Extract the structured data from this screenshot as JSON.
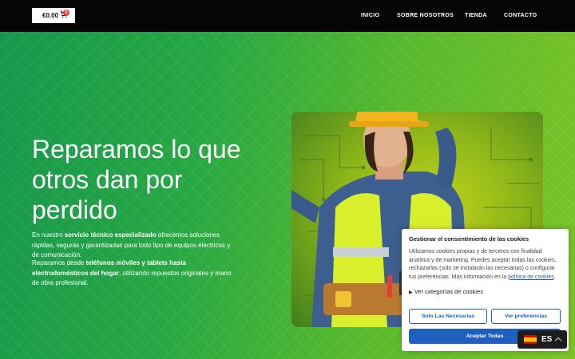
{
  "header": {
    "cart_price": "€0.00",
    "cart_count": "0",
    "nav": [
      {
        "label": "INICIO"
      },
      {
        "label": "SOBRE NOSOTROS"
      },
      {
        "label": "TIENDA"
      },
      {
        "label": "CONTACTO"
      }
    ]
  },
  "hero": {
    "heading": "Reparamos lo que otros dan por perdido",
    "p1_a": "En nuestro ",
    "p1_b": "servicio técnico especializado",
    "p1_c": " ofrecemos soluciones rápidas, seguras y garantizadas para todo tipo de equipos eléctricos y de comunicación.",
    "p2_a": "Reparamos desde ",
    "p2_b": "teléfonos móviles y tablets hasta electrodomésticos del hogar",
    "p2_c": ", utilizando repuestos originales y mano de obra profesional."
  },
  "cookie": {
    "title": "Gestionar el consentimiento de las cookies",
    "body": "Utilizamos cookies propias y de terceros con finalidad analítica y de marketing. Puedes aceptar todas las cookies, rechazarlas (solo se instalarán las necesarias) o configurar tus preferencias. Más información en la ",
    "link": "política de cookies",
    "body_end": ".",
    "categories": "Ver categorías de cookies",
    "btn_necessary": "Solo Las Necesarias",
    "btn_prefs": "Ver preferencias",
    "btn_accept": "Aceptar Todas"
  },
  "language": {
    "code": "ES"
  },
  "colors": {
    "accent": "#1f5fbf",
    "topbar": "#050505",
    "badge": "#e4463f"
  }
}
